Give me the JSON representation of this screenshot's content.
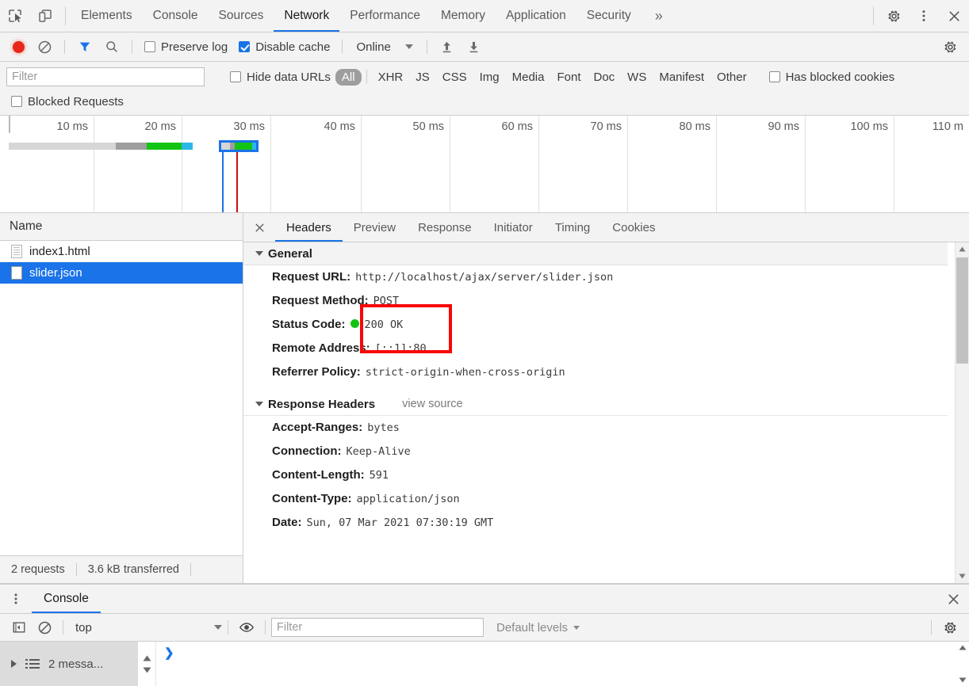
{
  "devtools": {
    "top_tabs": [
      {
        "label": "Elements",
        "selected": false
      },
      {
        "label": "Console",
        "selected": false
      },
      {
        "label": "Sources",
        "selected": false
      },
      {
        "label": "Network",
        "selected": true
      },
      {
        "label": "Performance",
        "selected": false
      },
      {
        "label": "Memory",
        "selected": false
      },
      {
        "label": "Application",
        "selected": false
      },
      {
        "label": "Security",
        "selected": false
      }
    ],
    "more_tabs_label": "»",
    "icons": {
      "inspect": "inspect-element-icon",
      "device": "device-toolbar-icon",
      "settings": "gear-icon",
      "menu": "kebab-menu-icon",
      "close": "close-icon"
    }
  },
  "network_toolbar": {
    "record_title": "record-button",
    "clear_title": "clear-button",
    "filter_title": "filter-button",
    "search_title": "search-button",
    "preserve_log": {
      "label": "Preserve log",
      "checked": false
    },
    "disable_cache": {
      "label": "Disable cache",
      "checked": true
    },
    "throttle": {
      "value": "Online"
    },
    "import_title": "import-har-icon",
    "export_title": "export-har-icon",
    "settings_title": "network-settings-icon"
  },
  "filter_bar": {
    "filter_placeholder": "Filter",
    "filter_value": "",
    "hide_data_urls": {
      "label": "Hide data URLs",
      "checked": false
    },
    "types": [
      {
        "label": "All",
        "active": true
      },
      {
        "label": "XHR",
        "active": false
      },
      {
        "label": "JS",
        "active": false
      },
      {
        "label": "CSS",
        "active": false
      },
      {
        "label": "Img",
        "active": false
      },
      {
        "label": "Media",
        "active": false
      },
      {
        "label": "Font",
        "active": false
      },
      {
        "label": "Doc",
        "active": false
      },
      {
        "label": "WS",
        "active": false
      },
      {
        "label": "Manifest",
        "active": false
      },
      {
        "label": "Other",
        "active": false
      }
    ],
    "has_blocked_cookies": {
      "label": "Has blocked cookies",
      "checked": false
    },
    "blocked_requests": {
      "label": "Blocked Requests",
      "checked": false
    }
  },
  "overview": {
    "ticks": [
      "10 ms",
      "20 ms",
      "30 ms",
      "40 ms",
      "50 ms",
      "60 ms",
      "70 ms",
      "80 ms",
      "90 ms",
      "100 ms",
      "110 m"
    ],
    "bars": [
      {
        "name": "index1.html",
        "left_pct": 0.9,
        "width_pct": 19.0,
        "segments": [
          {
            "color": "#d6d6d6",
            "start_pct": 0,
            "width_pct": 58
          },
          {
            "color": "#9e9e9e",
            "start_pct": 58,
            "width_pct": 17
          },
          {
            "color": "#14c414",
            "start_pct": 75,
            "width_pct": 19
          },
          {
            "color": "#2bb8e8",
            "start_pct": 94,
            "width_pct": 6
          }
        ]
      },
      {
        "name": "slider.json",
        "left_pct": 22.8,
        "width_pct": 4.5,
        "selected": true,
        "segments": [
          {
            "color": "#d6d6d6",
            "start_pct": 0,
            "width_pct": 26
          },
          {
            "color": "#9e9e9e",
            "start_pct": 26,
            "width_pct": 13
          },
          {
            "color": "#14c414",
            "start_pct": 39,
            "width_pct": 49
          },
          {
            "color": "#2bb8e8",
            "start_pct": 88,
            "width_pct": 12
          }
        ]
      }
    ],
    "event_lines": [
      {
        "color": "#1a73e8",
        "pos_pct": 22.95,
        "name": "dom-content-loaded-line"
      },
      {
        "color": "#c8100f",
        "pos_pct": 24.4,
        "name": "load-event-line"
      }
    ]
  },
  "request_list": {
    "column_header": "Name",
    "rows": [
      {
        "name": "index1.html",
        "icon": "document-icon",
        "selected": false
      },
      {
        "name": "slider.json",
        "icon": "file-icon",
        "selected": true
      }
    ],
    "status": {
      "requests": "2 requests",
      "transferred": "3.6 kB transferred"
    }
  },
  "details": {
    "tabs": [
      {
        "label": "Headers",
        "selected": true
      },
      {
        "label": "Preview",
        "selected": false
      },
      {
        "label": "Response",
        "selected": false
      },
      {
        "label": "Initiator",
        "selected": false
      },
      {
        "label": "Timing",
        "selected": false
      },
      {
        "label": "Cookies",
        "selected": false
      }
    ],
    "general": {
      "title": "General",
      "rows": [
        {
          "key": "Request URL:",
          "value": "http://localhost/ajax/server/slider.json"
        },
        {
          "key": "Request Method:",
          "value": "POST"
        },
        {
          "key": "Status Code:",
          "value": "200 OK",
          "status_dot": "#14c414"
        },
        {
          "key": "Remote Address:",
          "value": "[::1]:80"
        },
        {
          "key": "Referrer Policy:",
          "value": "strict-origin-when-cross-origin"
        }
      ]
    },
    "response_headers": {
      "title": "Response Headers",
      "view_source": "view source",
      "rows": [
        {
          "key": "Accept-Ranges:",
          "value": "bytes"
        },
        {
          "key": "Connection:",
          "value": "Keep-Alive"
        },
        {
          "key": "Content-Length:",
          "value": "591"
        },
        {
          "key": "Content-Type:",
          "value": "application/json"
        },
        {
          "key": "Date:",
          "value": "Sun, 07 Mar 2021 07:30:19 GMT"
        }
      ]
    },
    "annotation": {
      "color": "#f80606",
      "name": "red-highlight-box"
    }
  },
  "console_drawer": {
    "tab_label": "Console",
    "context": "top",
    "filter_placeholder": "Filter",
    "filter_value": "",
    "levels": "Default levels",
    "messages_label": "2 messa...",
    "prompt": "❯",
    "close_title": "close-drawer-icon",
    "settings_title": "console-settings-icon",
    "sidebar_title": "console-sidebar-icon",
    "clear_title": "clear-console-icon",
    "eye_title": "live-expression-icon"
  }
}
